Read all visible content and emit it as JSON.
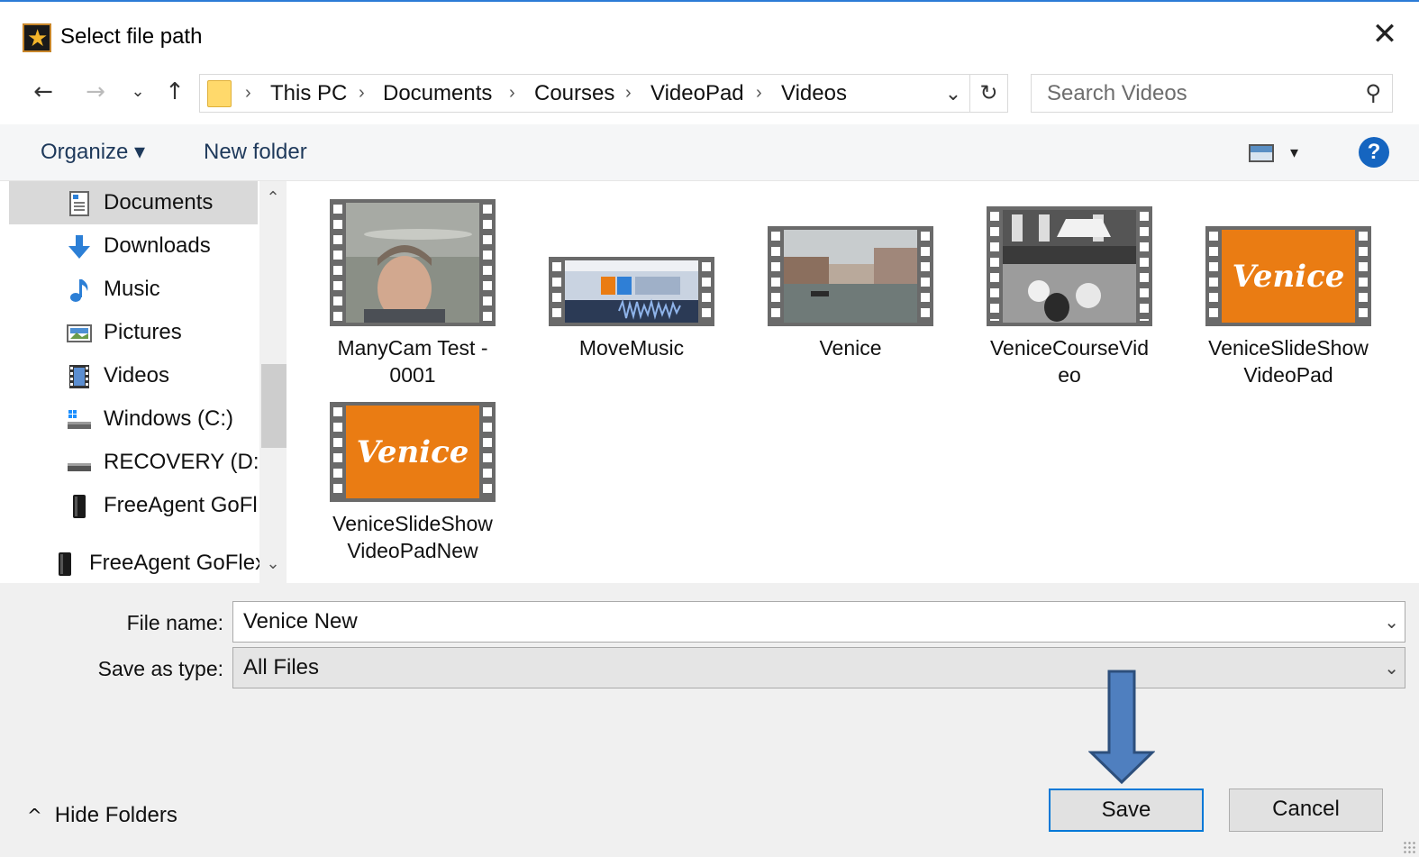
{
  "window": {
    "title": "Select file path",
    "close_glyph": "✕"
  },
  "nav": {
    "back_glyph": "←",
    "forward_glyph": "→",
    "recent_glyph": "⌄",
    "up_glyph": "↑",
    "breadcrumb": [
      "This PC",
      "Documents",
      "Courses",
      "VideoPad",
      "Videos"
    ],
    "crumb_sep": "›",
    "address_drop_glyph": "⌄",
    "refresh_glyph": "↻",
    "search_placeholder": "Search Videos",
    "search_glyph": "⚲"
  },
  "toolbar": {
    "organize_label": "Organize ▾",
    "new_folder_label": "New folder",
    "view_drop_glyph": "▾",
    "help_label": "?"
  },
  "sidebar": {
    "items": [
      {
        "label": "Documents",
        "icon": "documents-icon",
        "selected": true
      },
      {
        "label": "Downloads",
        "icon": "downloads-icon"
      },
      {
        "label": "Music",
        "icon": "music-icon"
      },
      {
        "label": "Pictures",
        "icon": "pictures-icon"
      },
      {
        "label": "Videos",
        "icon": "videos-icon"
      },
      {
        "label": "Windows (C:)",
        "icon": "drive-c-icon"
      },
      {
        "label": "RECOVERY (D:)",
        "icon": "drive-d-icon"
      },
      {
        "label": "FreeAgent GoFle",
        "icon": "external-drive-icon"
      },
      {
        "label": "FreeAgent GoFlex",
        "icon": "external-drive-icon"
      }
    ],
    "scroll_up_glyph": "⌃",
    "scroll_down_glyph": "⌄"
  },
  "files": [
    {
      "name": "ManyCam Test - 0001",
      "thumb": "webcam"
    },
    {
      "name": "MoveMusic",
      "thumb": "editor"
    },
    {
      "name": "Venice",
      "thumb": "canal"
    },
    {
      "name": "VeniceCourseVideo",
      "thumb": "plaza"
    },
    {
      "name": "VeniceSlideShowVideoPad",
      "thumb": "title-card",
      "card_text": "Venice"
    },
    {
      "name": "VeniceSlideShowVideoPadNew",
      "thumb": "title-card",
      "card_text": "Venice"
    }
  ],
  "file_labels": {
    "f0_l1": "ManyCam Test -",
    "f0_l2": "0001",
    "f1_l1": "MoveMusic",
    "f2_l1": "Venice",
    "f3_l1": "VeniceCourseVid",
    "f3_l2": "eo",
    "f4_l1": "VeniceSlideShow",
    "f4_l2": "VideoPad",
    "f5_l1": "VeniceSlideShow",
    "f5_l2": "VideoPadNew"
  },
  "form": {
    "file_name_label": "File name:",
    "file_name_value": "Venice New",
    "save_type_label": "Save as type:",
    "save_type_value": "All Files",
    "drop_glyph": "⌄"
  },
  "buttons": {
    "save": "Save",
    "cancel": "Cancel",
    "hide_folders": "Hide Folders",
    "hide_folders_glyph": "^"
  },
  "colors": {
    "accent": "#0078d7",
    "arrow_fill": "#4f7fbf",
    "arrow_stroke": "#2d4f7c",
    "card_orange": "#ea7c13"
  }
}
